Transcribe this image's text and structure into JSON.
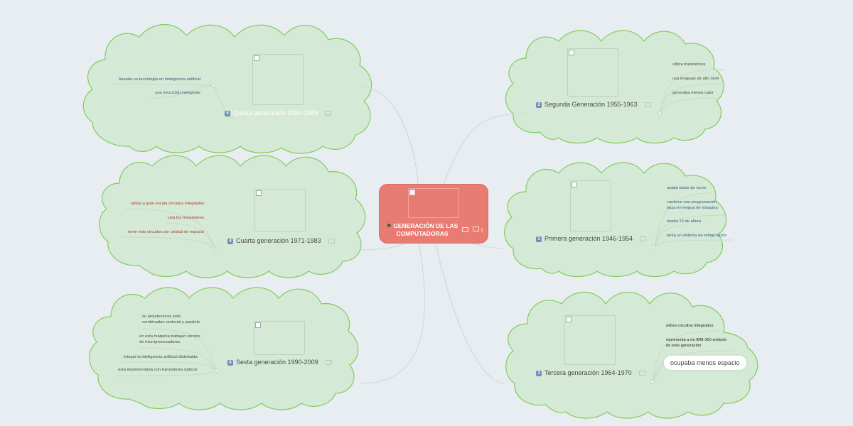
{
  "central": {
    "title_line1": "GENERACIÓN DE LAS",
    "title_line2": "COMPUTADORAS",
    "comment_count": "1"
  },
  "topics": {
    "quinta": {
      "number": "5",
      "label": "Quinta generación 1984-1989"
    },
    "cuarta": {
      "number": "4",
      "label": "Cuarta generación 1971-1983"
    },
    "sexta": {
      "number": "6",
      "label": "Sexta generación 1990-2009"
    },
    "segunda": {
      "number": "2",
      "label": "Segunda Generación  1955-1963"
    },
    "primera": {
      "number": "1",
      "label": "Primera generación 1946-1954"
    },
    "tercera": {
      "number": "3",
      "label": "Tercera generación 1964-1970"
    }
  },
  "leaves": {
    "quinta": [
      "basada su tecnologia en inteligencia artificial",
      "usa microchip inteligente"
    ],
    "cuarta": [
      "utiliza a gran escala circuitos integrados",
      "Usa los transistores",
      "tiene más circuitos por unidad de espacio"
    ],
    "sexta": [
      "su arquitecturas está",
      "combinadas vectorial y paralelo",
      "en esta máquina trabajan cientos",
      "de microprocesadores",
      "integra la inteligencia artificial distribuida",
      "esta implementada con transistores ópticos"
    ],
    "segunda": [
      "utiliza transistores",
      "usa lenguaje de alto nivel",
      "generaba menos calor"
    ],
    "primera": [
      "usaba tubos de vacío",
      "contiene una programación",
      "basa en lengua de máquina",
      "media 16 de altura",
      "tenía un sistema de refrigeración"
    ],
    "tercera": [
      "utiliza circuitos integrados",
      "representa a rla IBM 360 simbolo",
      "de esta generación",
      "ocupaba menos espacio"
    ]
  },
  "colors": {
    "background": "#e8edf1",
    "cloud_fill": "#d4ead6",
    "cloud_stroke": "#82cc58",
    "central_fill": "#e87b72",
    "badge": "#6e8fb6",
    "leaf_red": "#a43a30",
    "leaf_blue": "#345b7e"
  },
  "icons": [
    "flag-icon",
    "note-icon",
    "comment-icon",
    "broken-image-icon",
    "topic-number-badge"
  ]
}
